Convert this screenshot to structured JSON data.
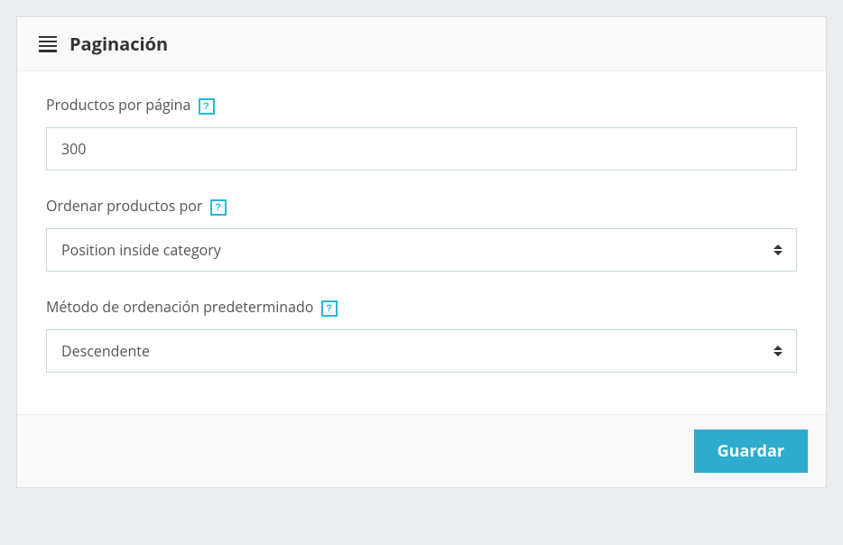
{
  "panel": {
    "title": "Paginación"
  },
  "fields": {
    "products_per_page": {
      "label": "Productos por página",
      "value": "300"
    },
    "sort_by": {
      "label": "Ordenar productos por",
      "value": "Position inside category"
    },
    "sort_method": {
      "label": "Método de ordenación predeterminado",
      "value": "Descendente"
    }
  },
  "help_symbol": "?",
  "footer": {
    "save_label": "Guardar"
  }
}
